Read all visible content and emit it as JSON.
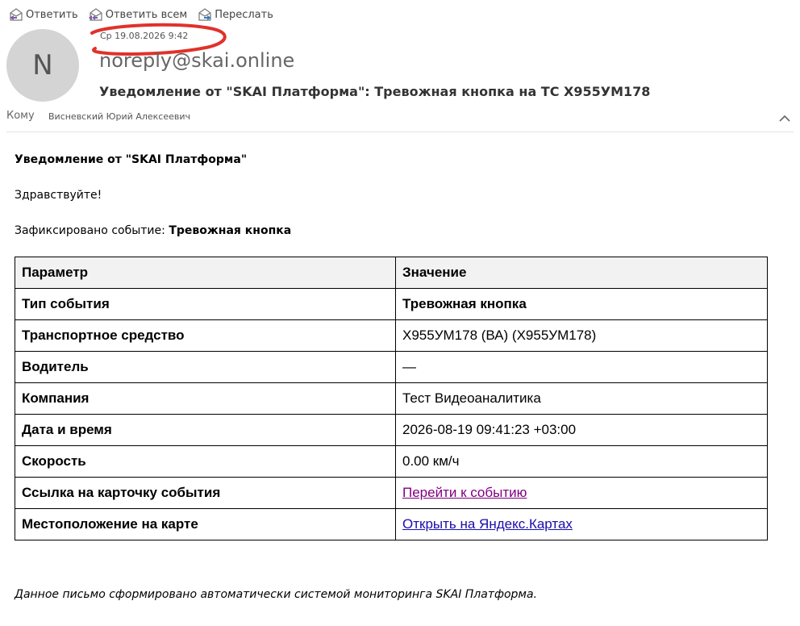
{
  "toolbar": {
    "reply": "Ответить",
    "reply_all": "Ответить всем",
    "forward": "Переслать"
  },
  "message": {
    "avatar_letter": "N",
    "date": "Ср 19.08.2026 9:42",
    "sender": "noreply@skai.online",
    "subject": "Уведомление от \"SKAI Платформа\": Тревожная кнопка на ТС Х955УМ178",
    "to_label": "Кому",
    "to_name": "Висневский Юрий Алексеевич"
  },
  "body": {
    "heading": "Уведомление от \"SKAI Платформа\"",
    "greeting": "Здравствуйте!",
    "event_prefix": "Зафиксировано событие: ",
    "event_name": "Тревожная кнопка",
    "table": {
      "headers": [
        "Параметр",
        "Значение"
      ],
      "rows": [
        {
          "key": "Тип события",
          "value": "Тревожная кнопка"
        },
        {
          "key": "Транспортное средство",
          "value": "Х955УМ178 (ВА) (Х955УМ178)"
        },
        {
          "key": "Водитель",
          "value": "—"
        },
        {
          "key": "Компания",
          "value": "Тест Видеоаналитика"
        },
        {
          "key": "Дата и время",
          "value": "2026-08-19 09:41:23 +03:00"
        },
        {
          "key": "Скорость",
          "value": "0.00 км/ч"
        },
        {
          "key": "Ссылка на карточку события",
          "value": "Перейти к событию"
        },
        {
          "key": "Местоположение на карте",
          "value": "Открыть на Яндекс.Картах"
        }
      ]
    },
    "footer": "Данное письмо сформировано автоматически системой мониторинга SKAI Платформа."
  },
  "colors": {
    "annotation": "#e0322a",
    "visited_link": "#800080",
    "link": "#1a0dab",
    "header_bg": "#f2f2f2"
  }
}
